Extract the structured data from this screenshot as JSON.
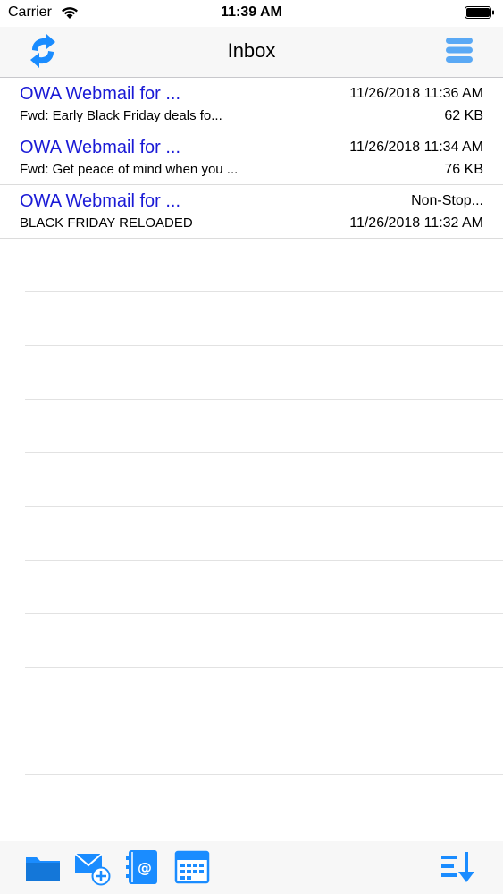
{
  "status_bar": {
    "carrier": "Carrier",
    "time": "11:39 AM"
  },
  "nav_bar": {
    "title": "Inbox",
    "left_icon": "refresh-icon",
    "right_icon": "menu-icon"
  },
  "messages": [
    {
      "sender": "OWA Webmail for ...",
      "subject": "Fwd: Early Black Friday deals fo...",
      "meta_top": "11/26/2018 11:36 AM",
      "meta_bottom": "62 KB"
    },
    {
      "sender": "OWA Webmail for ...",
      "subject": "Fwd: Get peace of mind when you ...",
      "meta_top": "11/26/2018 11:34 AM",
      "meta_bottom": "76 KB"
    },
    {
      "sender": "OWA Webmail for ...",
      "subject": "BLACK FRIDAY RELOADED",
      "meta_top": "Non-Stop...",
      "meta_bottom": "11/26/2018 11:32 AM"
    }
  ],
  "tab_bar": {
    "icons": [
      "folder-icon",
      "compose-mail-icon",
      "address-book-icon",
      "calendar-icon",
      "sort-icon"
    ]
  },
  "colors": {
    "accent": "#1a8cff",
    "sender_text": "#1a1ad6"
  }
}
